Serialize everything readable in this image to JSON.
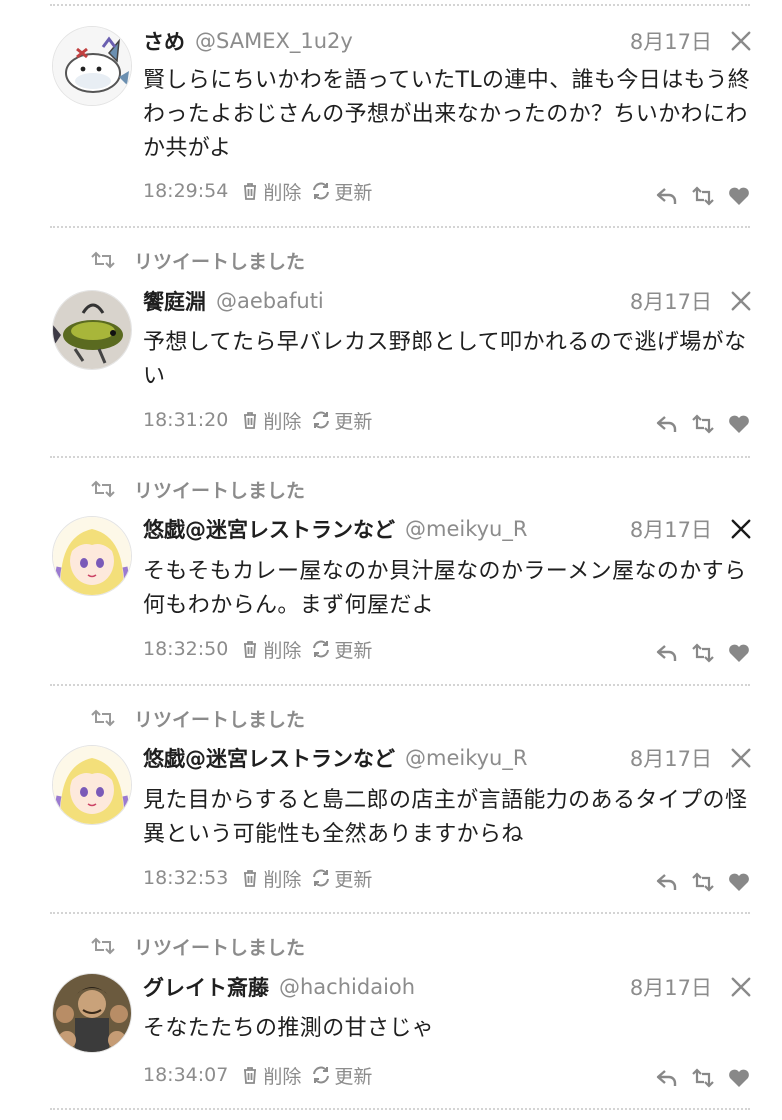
{
  "retweet_label": "リツイートしました",
  "meta_labels": {
    "delete": "削除",
    "refresh": "更新"
  },
  "posts": [
    {
      "name": "さめ",
      "handle": "@SAMEX_1u2y",
      "date": "8月17日",
      "text": "賢しらにちいかわを語っていたTLの連中、誰も今日はもう終わったよおじさんの予想が出来なかったのか？ちいかわにわか共がよ",
      "time": "18:29:54",
      "retweeted": false
    },
    {
      "name": "饗庭淵",
      "handle": "@aebafuti",
      "date": "8月17日",
      "text": "予想してたら早バレカス野郎として叩かれるので逃げ場がない",
      "time": "18:31:20",
      "retweeted": true
    },
    {
      "name": "悠戯@迷宮レストランなど",
      "handle": "@meikyu_R",
      "date": "8月17日",
      "text": "そもそもカレー屋なのか貝汁屋なのかラーメン屋なのかすら何もわからん。まず何屋だよ",
      "time": "18:32:50",
      "retweeted": true
    },
    {
      "name": "悠戯@迷宮レストランなど",
      "handle": "@meikyu_R",
      "date": "8月17日",
      "text": "見た目からすると島二郎の店主が言語能力のあるタイプの怪異という可能性も全然ありますからね",
      "time": "18:32:53",
      "retweeted": true
    },
    {
      "name": "グレイト斎藤",
      "handle": "@hachidaioh",
      "date": "8月17日",
      "text": "そなたたちの推測の甘さじゃ",
      "time": "18:34:07",
      "retweeted": true
    }
  ]
}
